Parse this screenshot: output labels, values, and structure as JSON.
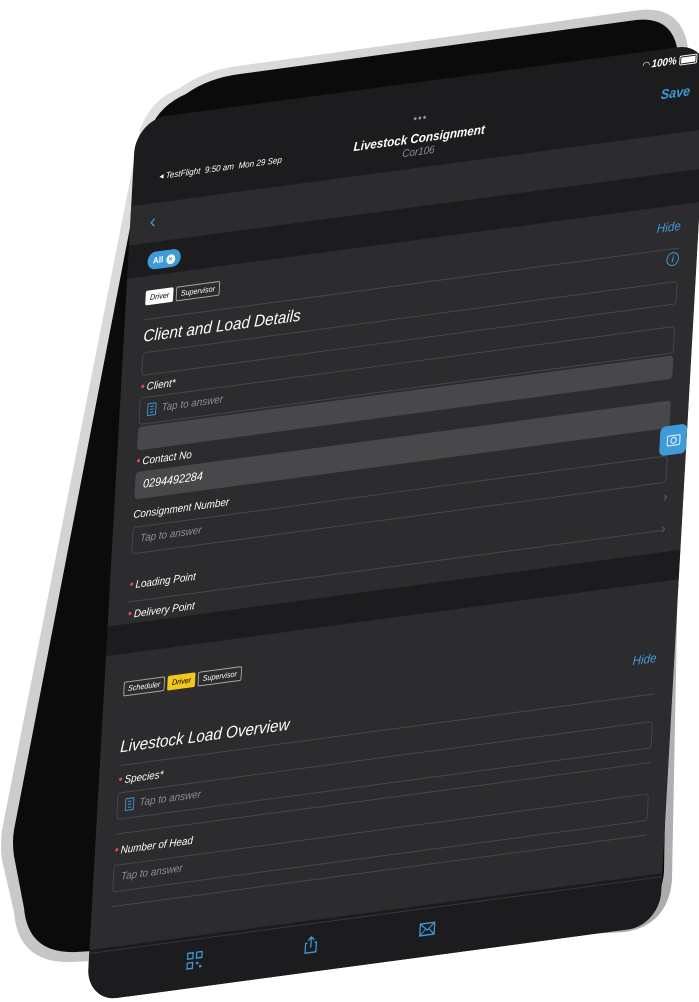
{
  "status": {
    "carrier": "◂ TestFlight",
    "time": "9:50 am",
    "date": "Mon 29 Sep",
    "battery": "100%"
  },
  "nav": {
    "dots": "•••",
    "title": "Livestock Consignment",
    "subtitle": "Cor106",
    "save_label": "Save"
  },
  "filter": {
    "label": "All",
    "clear": "×"
  },
  "section1": {
    "roles": [
      "Driver",
      "Supervisor"
    ],
    "active_role": "Driver",
    "hide_label": "Hide",
    "info": "i",
    "title": "Client and Load Details",
    "fields": {
      "client": {
        "label": "Client*",
        "placeholder": "Tap to answer"
      },
      "contact": {
        "label": "Contact No",
        "value": "0294492284"
      },
      "consignment": {
        "label": "Consignment Number",
        "placeholder": "Tap to answer"
      },
      "loading": {
        "label": "Loading Point"
      },
      "delivery": {
        "label": "Delivery Point"
      }
    }
  },
  "section2": {
    "roles": [
      "Scheduler",
      "Driver",
      "Supervisor"
    ],
    "active_role": "Driver",
    "hide_label": "Hide",
    "title": "Livestock Load Overview",
    "fields": {
      "species": {
        "label": "Species*",
        "placeholder": "Tap to answer"
      },
      "head": {
        "label": "Number of Head",
        "placeholder": "Tap to answer"
      }
    }
  },
  "icons": {
    "qr": "qr-code-icon",
    "share": "share-icon",
    "mail": "mail-icon",
    "camera": "camera-icon",
    "back": "chevron-left-icon"
  },
  "colors": {
    "accent": "#3e9bd8",
    "required": "#e5484d",
    "highlight": "#f2c81f",
    "background": "#1c1c1e",
    "card": "#2c2c2e"
  }
}
